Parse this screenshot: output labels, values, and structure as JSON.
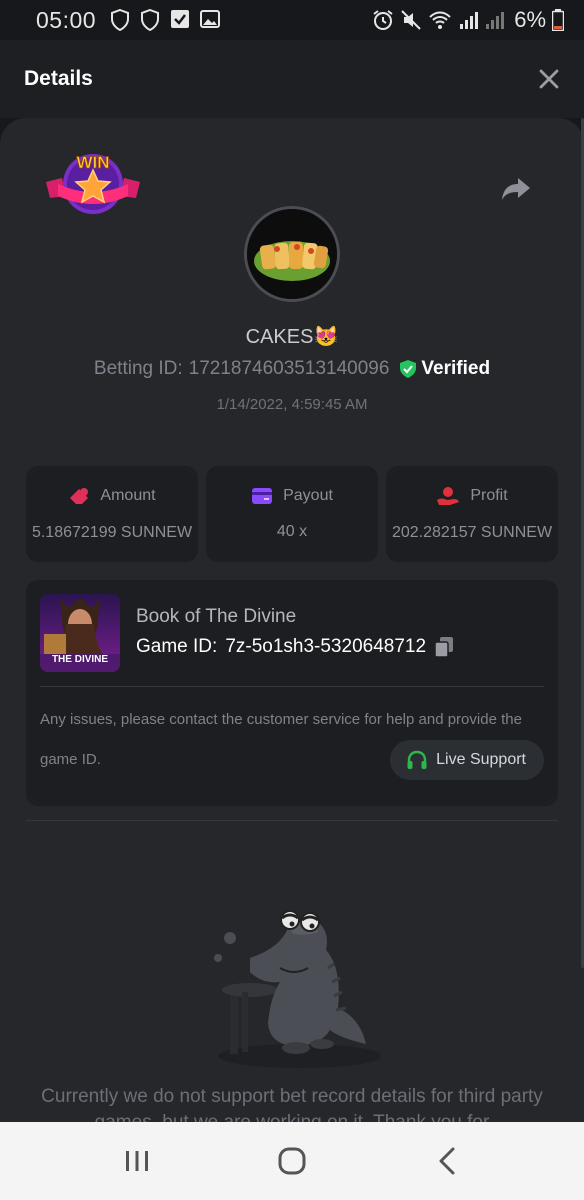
{
  "status_bar": {
    "time": "05:00",
    "battery": "6%"
  },
  "header": {
    "title": "Details"
  },
  "player": {
    "username": "CAKES😻",
    "betting_id_label": "Betting ID:",
    "betting_id": "1721874603513140096",
    "verified_label": "Verified",
    "timestamp": "1/14/2022, 4:59:45 AM"
  },
  "stats": [
    {
      "label": "Amount",
      "value": "5.18672199 SUNNEW",
      "icon": "amount-icon",
      "color": "#e0305a"
    },
    {
      "label": "Payout",
      "value": "40 x",
      "icon": "payout-card-icon",
      "color": "#8a4bff"
    },
    {
      "label": "Profit",
      "value": "202.282157 SUNNEW",
      "icon": "profit-hand-icon",
      "color": "#e0303a"
    }
  ],
  "game": {
    "name": "Book of The Divine",
    "id_label": "Game ID:",
    "id": "7z-5o1sh3-5320648712",
    "thumb_text": "THE DIVINE",
    "notice": "Any issues, please contact the customer service for help and provide the game ID.",
    "support_label": "Live Support"
  },
  "third_party_notice": "Currently we do not support bet record details for third party games, but we are working on it. Thank you for",
  "colors": {
    "accent_green": "#2db84a",
    "verified_green": "#22c55e"
  }
}
